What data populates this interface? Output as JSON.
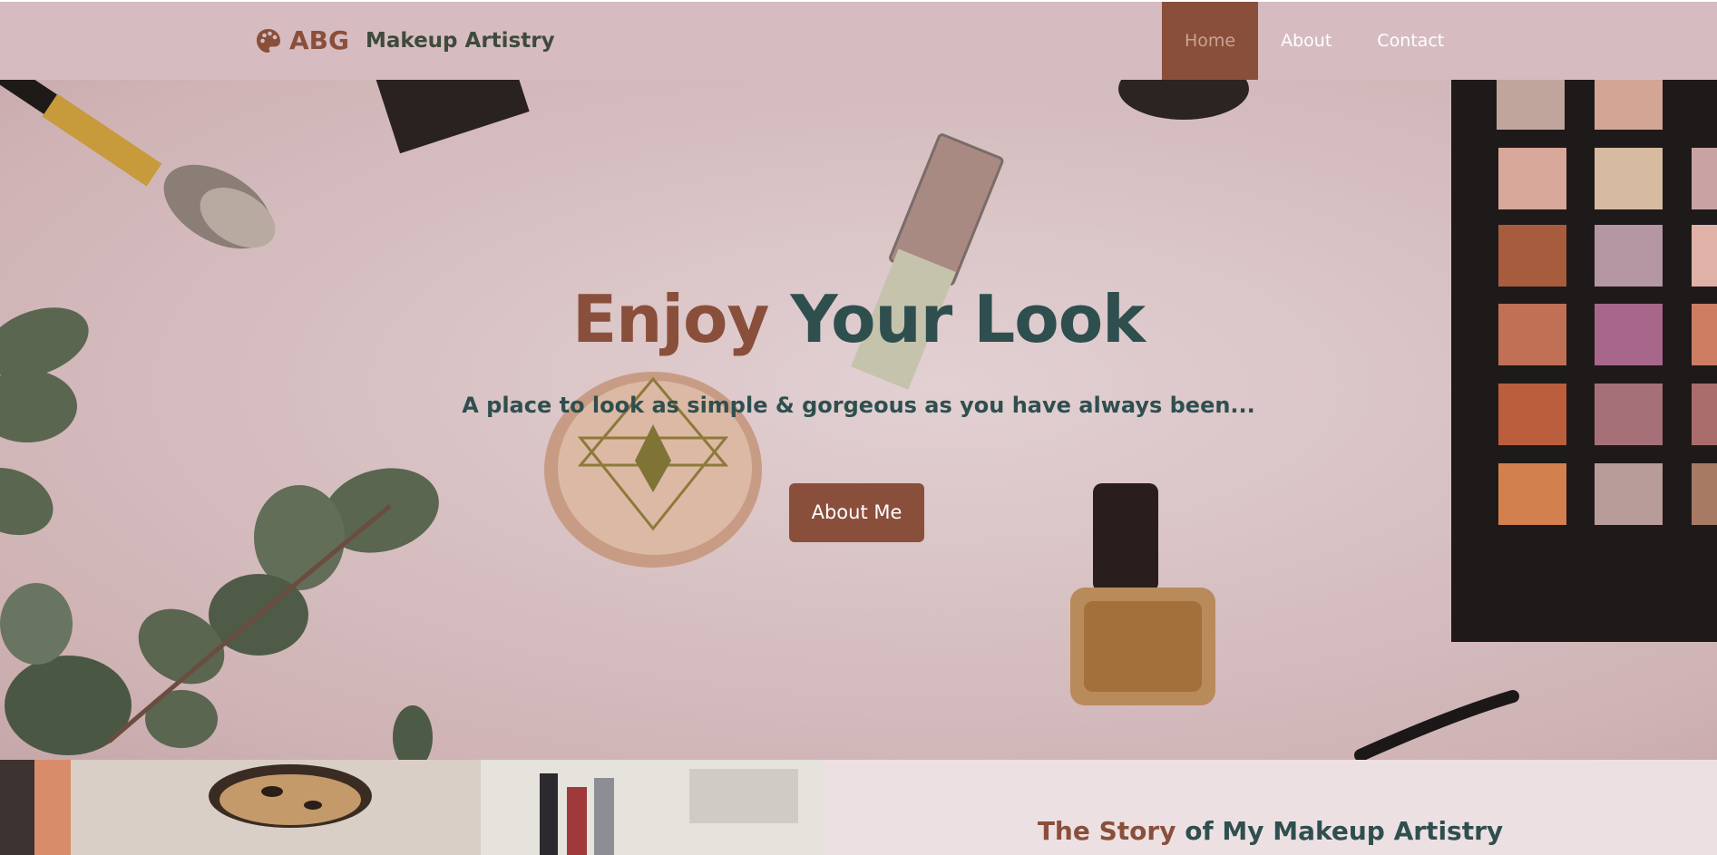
{
  "brand": {
    "abg": "ABG",
    "name": "Makeup Artistry",
    "icon": "palette-icon"
  },
  "nav": {
    "items": [
      {
        "label": "Home",
        "active": true
      },
      {
        "label": "About"
      },
      {
        "label": "Contact"
      }
    ]
  },
  "hero": {
    "title_part1": "Enjoy",
    "title_part2": "Your Look",
    "subtitle": "A place to look as simple & gorgeous as you have always been...",
    "button": "About Me"
  },
  "story": {
    "title_part1": "The Story",
    "title_part2": "of My Makeup Artistry"
  },
  "colors": {
    "nav_bg": "#d6bcc1",
    "brown": "#8a4f3b",
    "teal": "#2f4f4f",
    "story_bg": "#ede0e3"
  }
}
